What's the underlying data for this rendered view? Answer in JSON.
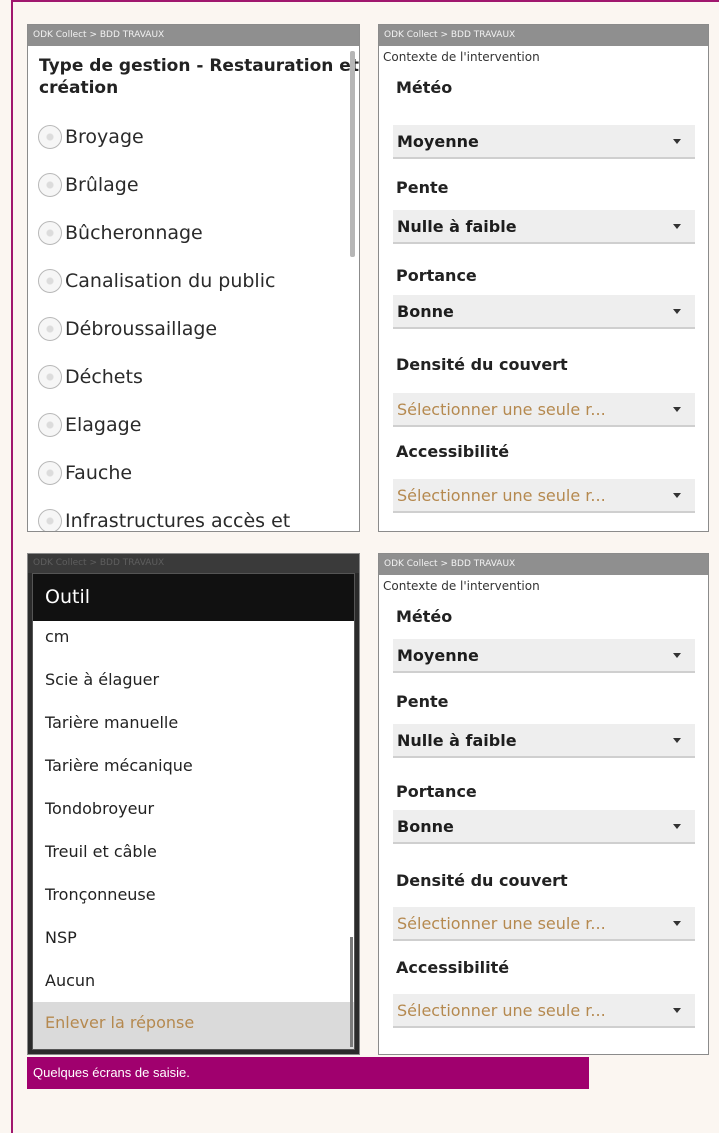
{
  "app": {
    "statusbar_title": "ODK Collect > BDD TRAVAUX",
    "dim_statusbar_title": "ODK Collect > BDD TRAVAUX"
  },
  "screen1": {
    "question": "Type de gestion - Restauration et création",
    "options": [
      "Broyage",
      "Brûlage",
      "Bûcheronnage",
      "Canalisation du public",
      "Débroussaillage",
      "Déchets",
      "Elagage",
      "Fauche",
      "Infrastructures accès et"
    ]
  },
  "form": {
    "context_label": "Contexte de l'intervention",
    "fields": [
      {
        "label": "Météo",
        "value": "Moyenne"
      },
      {
        "label": "Pente",
        "value": "Nulle à faible"
      },
      {
        "label": "Portance",
        "value": "Bonne"
      },
      {
        "label": "Densité du couvert",
        "value": "Sélectionner une seule r..."
      },
      {
        "label": "Accessibilité",
        "value": "Sélectionner une seule r..."
      }
    ]
  },
  "dialog": {
    "title": "Outil",
    "options": [
      "cm",
      "Scie à élaguer",
      "Tarière manuelle",
      "Tarière mécanique",
      "Tondobroyeur",
      "Treuil et câble",
      "Tronçonneuse",
      "NSP",
      "Aucun"
    ],
    "clear_label": "Enlever la réponse"
  },
  "caption": "Quelques écrans de saisie.",
  "colors": {
    "accent": "#a0006e",
    "placeholder": "#b5894f",
    "statusbar": "#8f8f8f"
  },
  "icons": {
    "radio": "radio-button-icon",
    "dropdown": "dropdown-caret-icon"
  }
}
